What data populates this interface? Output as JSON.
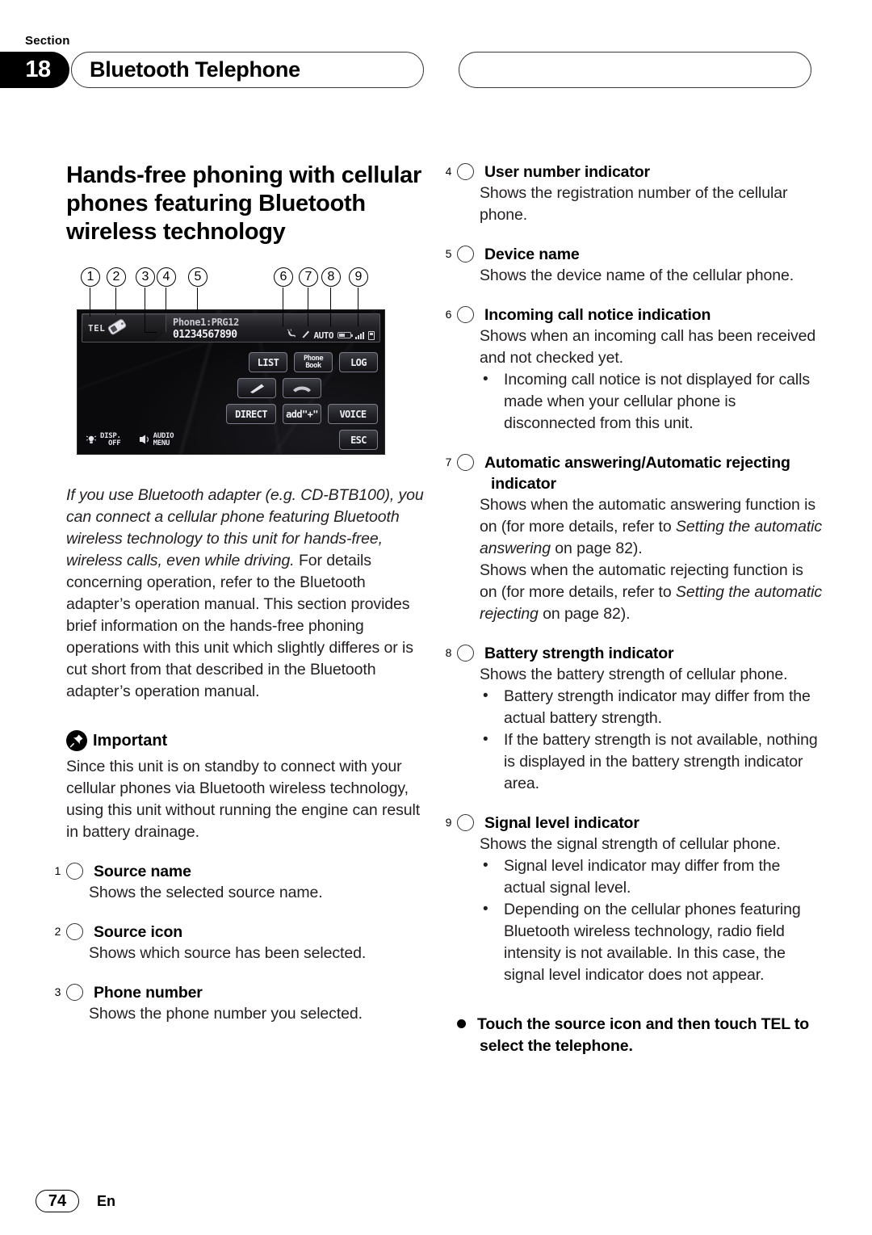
{
  "header": {
    "section_label": "Section",
    "section_number": "18",
    "title": "Bluetooth Telephone"
  },
  "heading": "Hands-free phoning with cellular phones featuring Bluetooth wireless technology",
  "figure": {
    "callout_numbers": [
      "1",
      "2",
      "3",
      "4",
      "5",
      "6",
      "7",
      "8",
      "9"
    ],
    "device_screen": {
      "source_name": "TEL",
      "device_name": "Phone1:PRG12",
      "phone_number": "01234567890",
      "auto_indicator": "AUTO",
      "keys": [
        "LIST",
        "Phone",
        "Book",
        "LOG",
        "DIRECT",
        "add\"+\"",
        "VOICE",
        "ESC"
      ],
      "key_list": "LIST",
      "key_phonebook_line1": "Phone",
      "key_phonebook_line2": "Book",
      "key_log": "LOG",
      "key_direct": "DIRECT",
      "key_add": "add\"+\"",
      "key_voice": "VOICE",
      "key_esc": "ESC",
      "soft_disp_line1": "DISP.",
      "soft_disp_line2": "OFF",
      "soft_audio_line1": "AUDIO",
      "soft_audio_line2": "MENU"
    }
  },
  "intro": {
    "italic_part": "If you use Bluetooth adapter (e.g. CD-BTB100), you can connect a cellular phone featuring Bluetooth wireless technology to this unit for hands-free, wireless calls, even while driving.",
    "roman_part": "For details concerning operation, refer to the Bluetooth adapter’s operation manual. This section provides brief information on the hands-free phoning operations with this unit which slightly differes or is cut short from that described in the Bluetooth adapter’s operation manual."
  },
  "important": {
    "label": "Important",
    "text": "Since this unit is on standby to connect with your cellular phones via Bluetooth wireless technology, using this unit without running the engine can result in battery drainage."
  },
  "items": [
    {
      "num": "①",
      "title": "Source name",
      "body": "Shows the selected source name."
    },
    {
      "num": "②",
      "title": "Source icon",
      "body": "Shows which source has been selected."
    },
    {
      "num": "③",
      "title": "Phone number",
      "body": "Shows the phone number you selected."
    },
    {
      "num": "④",
      "title": "User number indicator",
      "body": "Shows the registration number of the cellular phone."
    },
    {
      "num": "⑤",
      "title": "Device name",
      "body": "Shows the device name of the cellular phone."
    },
    {
      "num": "⑥",
      "title": "Incoming call notice indication",
      "body": "Shows when an incoming call has been received and not checked yet.",
      "bullets": [
        "Incoming call notice is not displayed for calls made when your cellular phone is disconnected from this unit."
      ]
    },
    {
      "num": "⑦",
      "title": "Automatic answering/Automatic rejecting indicator",
      "body_parts": {
        "p1_a": "Shows when the automatic answering function is on (for more details, refer to ",
        "p1_it": "Setting the automatic answering",
        "p1_b": " on page 82).",
        "p2_a": "Shows when the automatic rejecting function is on (for more details, refer to ",
        "p2_it": "Setting the automatic rejecting",
        "p2_b": " on page 82)."
      }
    },
    {
      "num": "⑧",
      "title": "Battery strength indicator",
      "body": "Shows the battery strength of cellular phone.",
      "bullets": [
        "Battery strength indicator may differ from the actual battery strength.",
        "If the battery strength is not available, nothing is displayed in the battery strength indicator area."
      ]
    },
    {
      "num": "⑨",
      "title": "Signal level indicator",
      "body": "Shows the signal strength of cellular phone.",
      "bullets": [
        "Signal level indicator may differ from the actual signal level.",
        "Depending on the cellular phones featuring Bluetooth wireless technology, radio field intensity is not available. In this case, the signal level indicator does not appear."
      ]
    }
  ],
  "final_note": "Touch the source icon and then touch TEL to select the telephone.",
  "footer": {
    "page_number": "74",
    "language": "En"
  },
  "colors": {
    "ink": "#231f20",
    "black": "#000000",
    "screen_bg": "#0a0a0c"
  }
}
